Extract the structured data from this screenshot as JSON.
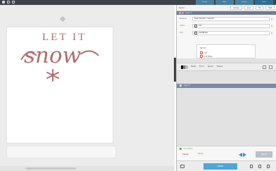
{
  "app": {
    "top_tabs": [
      {
        "label": "Design",
        "active": false
      },
      {
        "label": "Store",
        "active": false
      },
      {
        "label": "Library",
        "active": false
      },
      {
        "label": "Send",
        "active": true
      }
    ]
  },
  "canvas": {
    "design_text_line1": "LET IT",
    "design_text_line2": "snow",
    "accent_color": "#b06d6e"
  },
  "panel": {
    "header": {
      "title": "Send",
      "action1": "Simple",
      "action2": "Line",
      "action3": "Fill",
      "action4": "Mat"
    },
    "layer_label": "Layer 1",
    "properties": [
      {
        "key": "Material",
        "value": "Heat Transfer, Smooth",
        "icon": "caret-down-icon"
      },
      {
        "key": "Action",
        "value": "Cut",
        "icon": "knife-icon"
      },
      {
        "key": "Tool",
        "value": "AutoBlade",
        "icon": "blade-icon"
      }
    ],
    "card": {
      "title": "Set Up",
      "line1": "Cut",
      "line2": "Cut Edge"
    },
    "tools_bar": {
      "labels": [
        "Blade",
        "Force",
        "Speed",
        "Passes"
      ]
    },
    "section_label": "Layer 2",
    "send": {
      "status": "Connected",
      "machine": "Cameo",
      "machine_sub": "Ready",
      "send_label": "Send"
    },
    "footer": {
      "primary_label": "SEND"
    }
  }
}
